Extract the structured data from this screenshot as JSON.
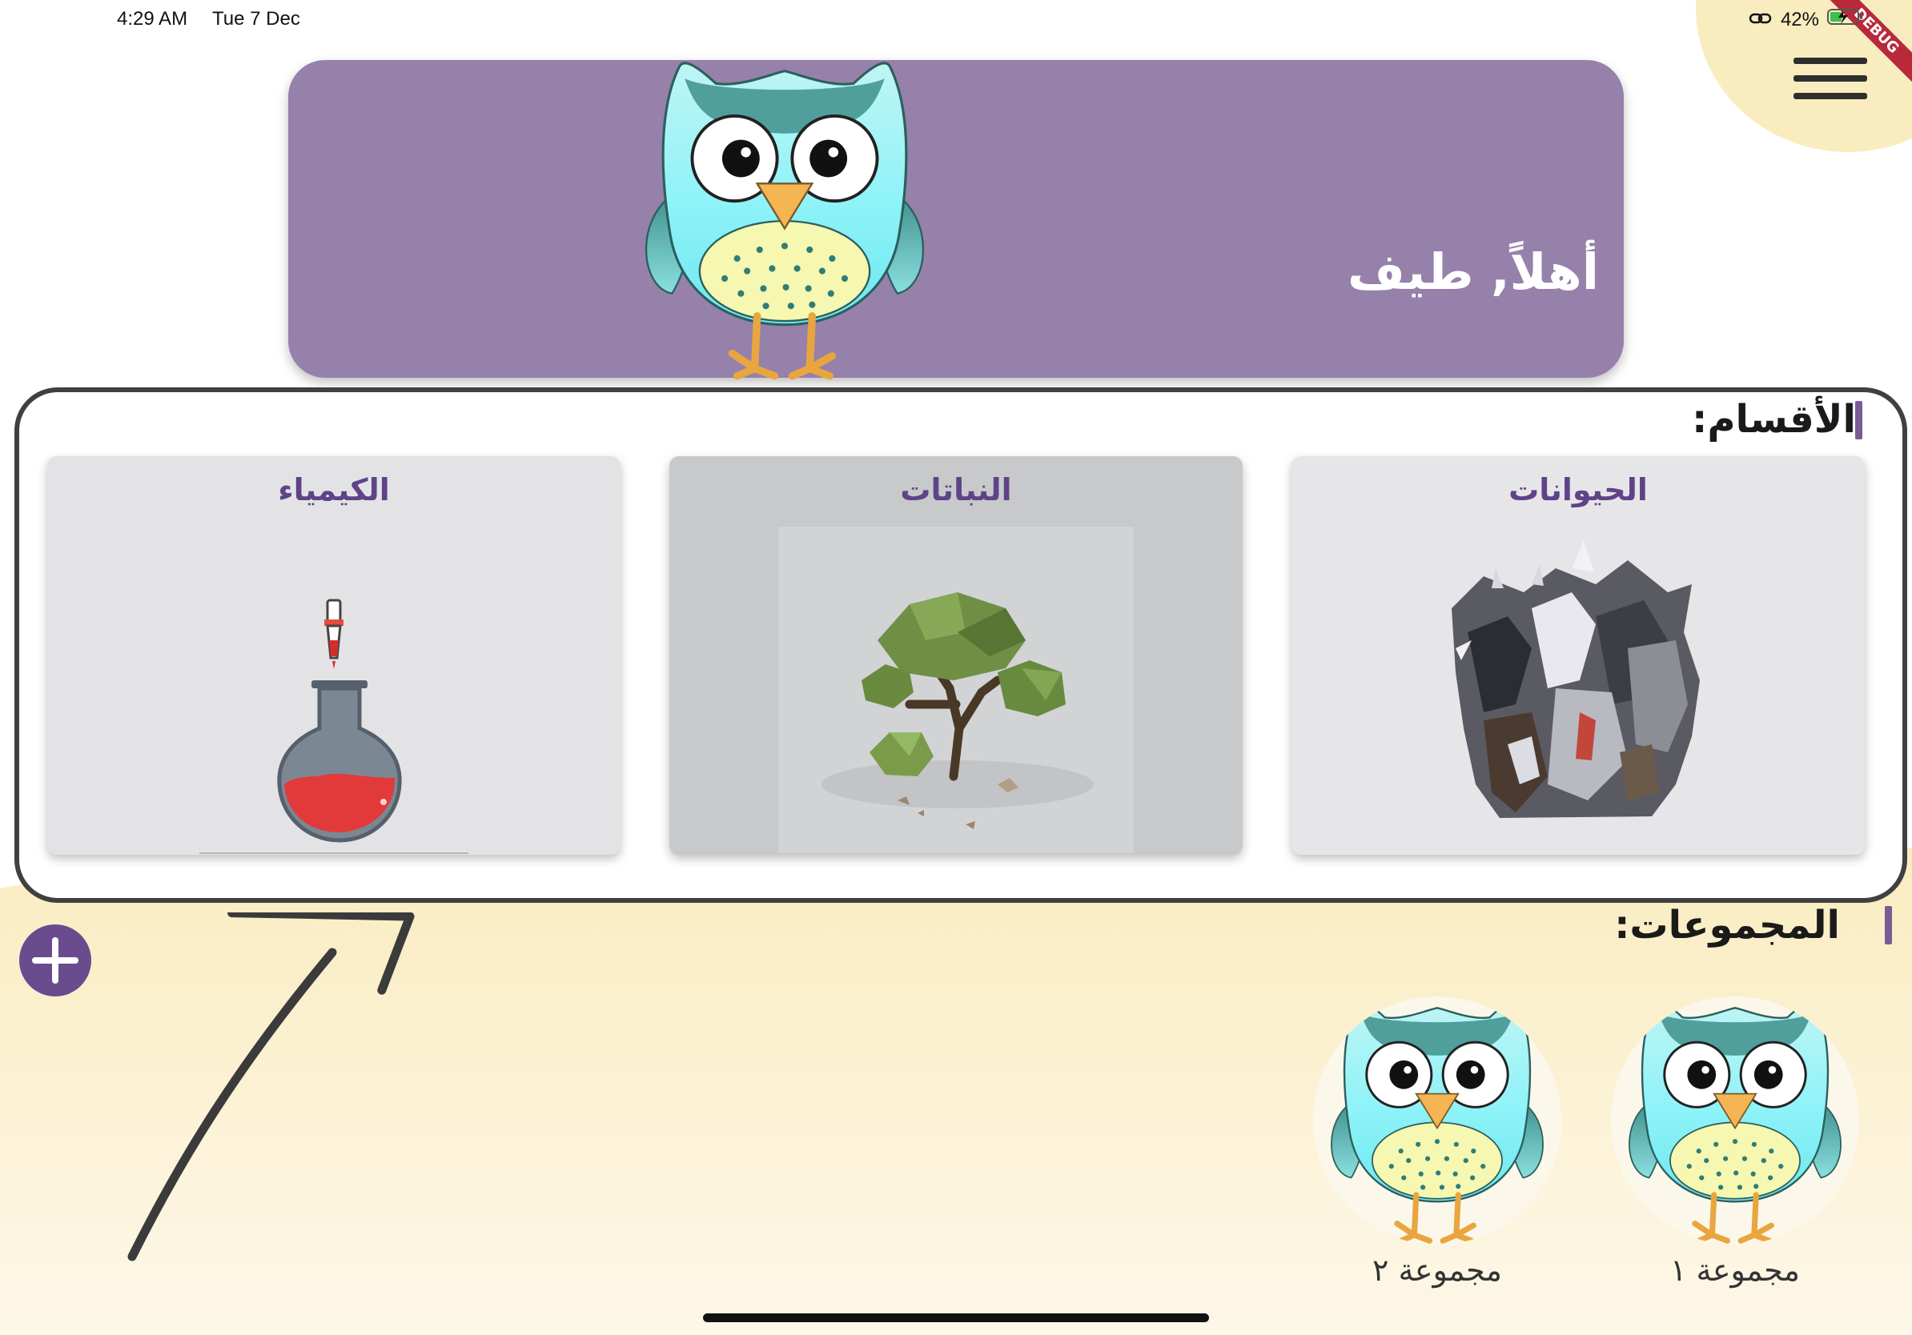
{
  "status_bar": {
    "time": "4:29 AM",
    "date": "Tue 7 Dec",
    "battery": "42%",
    "debug_label": "DEBUG"
  },
  "header": {
    "greeting": "أهلاً, طيف",
    "menu_icon": "hamburger-menu-icon",
    "mascot_icon": "owl-icon"
  },
  "categories": {
    "title": "الأقسام:",
    "items": [
      {
        "label": "الحيوانات",
        "icon": "animals-icon"
      },
      {
        "label": "النباتات",
        "icon": "tree-icon"
      },
      {
        "label": "الكيمياء",
        "icon": "flask-icon"
      }
    ]
  },
  "groups": {
    "title": "المجموعات:",
    "add_icon": "plus-icon",
    "items": [
      {
        "label": "مجموعة ١",
        "icon": "owl-icon"
      },
      {
        "label": "مجموعة ٢",
        "icon": "owl-icon"
      }
    ]
  },
  "colors": {
    "hero": "#9681ab",
    "accent": "#6a4b8e",
    "card_title": "#5f4388",
    "sand": "#f9edc0"
  }
}
